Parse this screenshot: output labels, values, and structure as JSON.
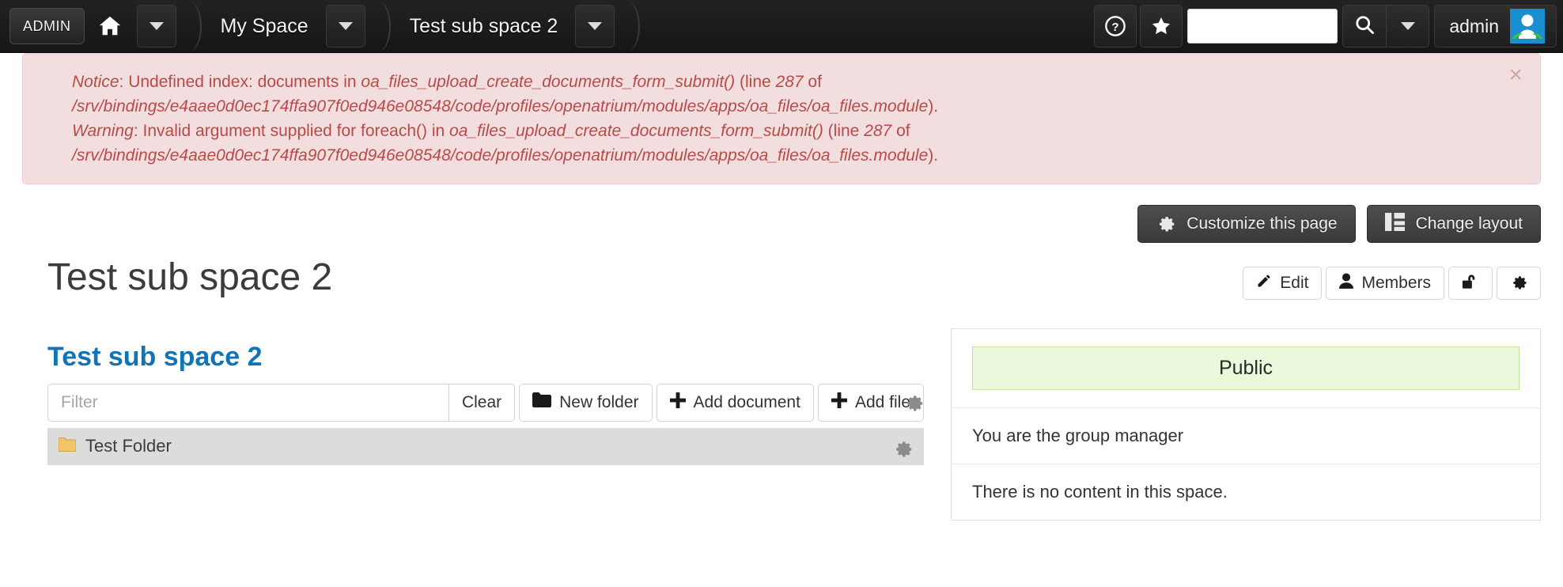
{
  "toolbar": {
    "admin_badge": "ADMIN",
    "home_icon": "home-icon",
    "home_caret": "chevron-down-icon",
    "space_label": "My Space",
    "space_caret": "chevron-down-icon",
    "subspace_label": "Test sub space 2",
    "subspace_caret": "chevron-down-icon",
    "help_icon": "question-circle-icon",
    "star_icon": "star-icon",
    "search_value": "",
    "search_placeholder": "",
    "search_icon": "search-icon",
    "search_caret": "chevron-down-icon",
    "username": "admin",
    "avatar_icon": "user-avatar"
  },
  "alert": {
    "close_label": "×",
    "line1_prefix": "Notice",
    "line1_a": ": Undefined index: documents in ",
    "line1_fn": "oa_files_upload_create_documents_form_submit()",
    "line1_b": " (line ",
    "line1_num": "287",
    "line1_c": " of ",
    "line1_path": "/srv/bindings/e4aae0d0ec174ffa907f0ed946e08548/code/profiles/openatrium/modules/apps/oa_files/oa_files.module",
    "line1_d": ").",
    "line2_prefix": "Warning",
    "line2_a": ": Invalid argument supplied for foreach() in ",
    "line2_fn": "oa_files_upload_create_documents_form_submit()",
    "line2_b": " (line ",
    "line2_num": "287",
    "line2_c": " of ",
    "line2_path": "/srv/bindings/e4aae0d0ec174ffa907f0ed946e08548/code/profiles/openatrium/modules/apps/oa_files/oa_files.module",
    "line2_d": ")."
  },
  "actions": {
    "customize_label": "Customize this page",
    "customize_icon": "gear-icon",
    "change_layout_label": "Change layout",
    "change_layout_icon": "layout-icon",
    "edit_label": "Edit",
    "edit_icon": "pencil-icon",
    "members_label": "Members",
    "members_icon": "person-icon",
    "lock_icon": "unlock-icon",
    "settings_icon": "gear-icon"
  },
  "main": {
    "page_title": "Test sub space 2",
    "panel_title": "Test sub space 2",
    "panel_gear_icon": "gear-icon",
    "filter_value": "",
    "filter_placeholder": "Filter",
    "clear_label": "Clear",
    "new_folder_label": "New folder",
    "new_folder_icon": "folder-icon",
    "add_document_label": "Add document",
    "add_document_icon": "plus-icon",
    "add_file_label": "Add file",
    "add_file_icon": "plus-icon",
    "rows": [
      {
        "name": "Test Folder",
        "icon": "folder-icon",
        "gear_icon": "gear-icon"
      }
    ]
  },
  "sidebar": {
    "visibility_badge": "Public",
    "role_text": "You are the group manager",
    "empty_text": "There is no content in this space."
  },
  "colors": {
    "toolbar_bg": "#1b1b1b",
    "alert_bg": "#f2dede",
    "alert_text": "#b94a48",
    "link_blue": "#1274b5",
    "public_green_bg": "#eaf8dc",
    "public_green_border": "#bfe6a0",
    "row_gray": "#dcdcdc",
    "avatar_blue": "#1a8fd0"
  }
}
